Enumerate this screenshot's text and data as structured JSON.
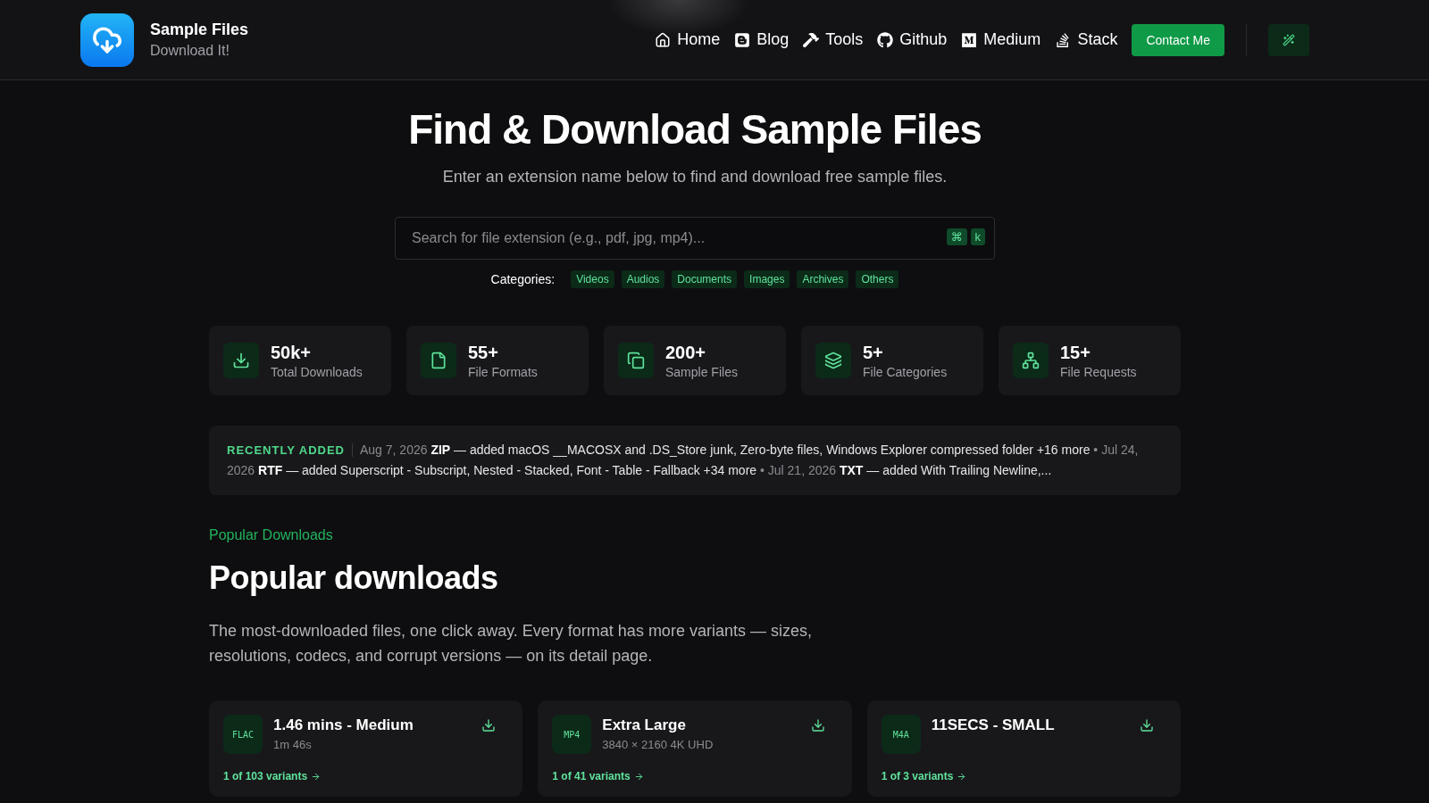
{
  "brand": {
    "title": "Sample Files",
    "subtitle": "Download It!"
  },
  "nav": [
    {
      "kind": "home",
      "label": "Home"
    },
    {
      "kind": "blog",
      "label": "Blog"
    },
    {
      "kind": "tools",
      "label": "Tools"
    },
    {
      "kind": "github",
      "label": "Github"
    },
    {
      "kind": "medium",
      "label": "Medium"
    },
    {
      "kind": "stack",
      "label": "Stack"
    }
  ],
  "contact_button": "Contact Me",
  "hero": {
    "title": "Find & Download Sample Files",
    "subtitle": "Enter an extension name below to find and download free sample files."
  },
  "search": {
    "placeholder": "Search for file extension (e.g., pdf, jpg, mp4)...",
    "keys": [
      "⌘",
      "k"
    ]
  },
  "categories": {
    "label": "Categories:",
    "items": [
      "Videos",
      "Audios",
      "Documents",
      "Images",
      "Archives",
      "Others"
    ]
  },
  "stats": [
    {
      "kind": "downloads",
      "value": "50k+",
      "label": "Total Downloads"
    },
    {
      "kind": "formats",
      "value": "55+",
      "label": "File Formats"
    },
    {
      "kind": "files",
      "value": "200+",
      "label": "Sample Files"
    },
    {
      "kind": "categories",
      "value": "5+",
      "label": "File Categories"
    },
    {
      "kind": "requests",
      "value": "15+",
      "label": "File Requests"
    }
  ],
  "recently_added": {
    "label": "RECENTLY ADDED",
    "separator": "•",
    "entries": [
      {
        "date": "Aug 7, 2026",
        "text": "**ZIP** — added macOS __MACOSX and .DS_Store junk, Zero-byte files, Windows Explorer compressed folder +16 more"
      },
      {
        "date": "Jul 24, 2026",
        "text": "**RTF** — added Superscript - Subscript, Nested - Stacked, Font - Table - Fallback +34 more"
      },
      {
        "date": "Jul 21, 2026",
        "text": "**TXT** — added With Trailing Newline,..."
      }
    ]
  },
  "popular": {
    "eyebrow": "Popular Downloads",
    "title": "Popular downloads",
    "description": "The most-downloaded files, one click away. Every format has more variants — sizes, resolutions, codecs, and corrupt versions — on its detail page.",
    "cards": [
      {
        "format": "FLAC",
        "title": "1.46 mins - Medium",
        "subtitle": "1m 46s",
        "variants": "1 of 103 variants"
      },
      {
        "format": "MP4",
        "title": "Extra Large",
        "subtitle": "3840 × 2160 4K UHD",
        "variants": "1 of 41 variants"
      },
      {
        "format": "M4A",
        "title": "11SECS - SMALL",
        "variants": "1 of 3 variants"
      }
    ]
  }
}
